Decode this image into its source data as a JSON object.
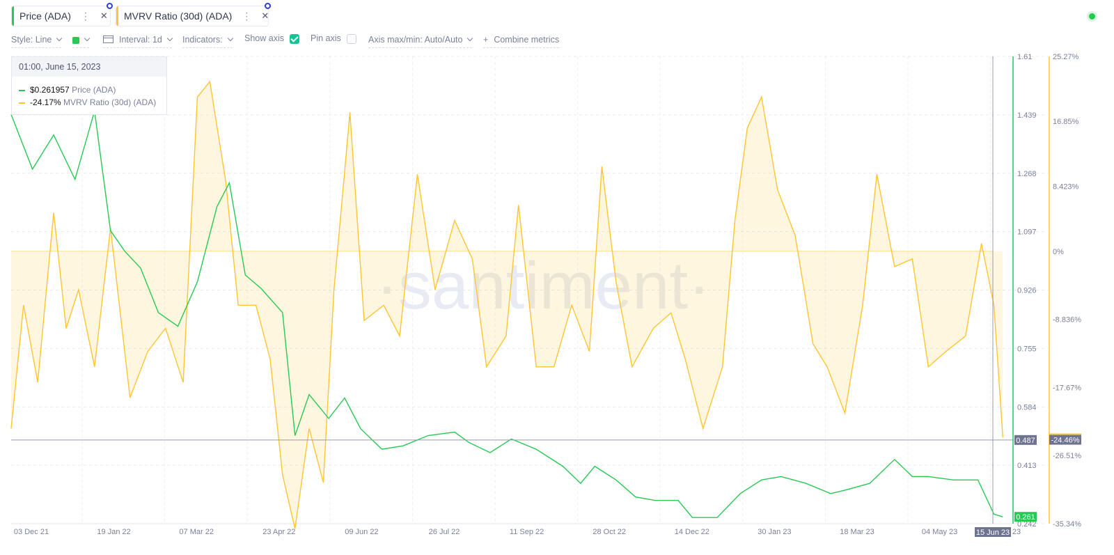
{
  "tabs": [
    {
      "label": "Price (ADA)",
      "color": "#26c953"
    },
    {
      "label": "MVRV Ratio (30d) (ADA)",
      "color": "#ffc532"
    }
  ],
  "icons": {
    "menu": "more-vertical-icon",
    "close": "close-icon",
    "settings": "settings-gear-icon",
    "status": "status-dot-icon"
  },
  "toolbar": {
    "style": "Style: Line",
    "interval": "Interval: 1d",
    "indicators": "Indicators:",
    "show_axis": "Show axis",
    "show_axis_checked": true,
    "pin_axis": "Pin axis",
    "pin_axis_checked": false,
    "axis_maxmin": "Axis max/min: Auto/Auto",
    "combine": "Combine metrics",
    "series_color": "#26c953"
  },
  "tooltip": {
    "date": "01:00, June 15, 2023",
    "rows": [
      {
        "value": "$0.261957",
        "label": "Price (ADA)",
        "color": "#26c953"
      },
      {
        "value": "-24.17%",
        "label": "MVRV Ratio (30d) (ADA)",
        "color": "#ffc532"
      }
    ]
  },
  "watermark": "·santiment·",
  "chart_data": {
    "type": "line",
    "x_labels": [
      "03 Dec 21",
      "19 Jan 22",
      "07 Mar 22",
      "23 Apr 22",
      "09 Jun 22",
      "26 Jul 22",
      "11 Sep 22",
      "28 Oct 22",
      "14 Dec 22",
      "30 Jan 23",
      "18 Mar 23",
      "04 May 23",
      "23"
    ],
    "cursor_label": "15 Jun 23",
    "price_axis": {
      "ticks": [
        "1.61",
        "1.439",
        "1.268",
        "1.097",
        "0.926",
        "0.755",
        "0.584",
        "0.413",
        "0.242"
      ],
      "min": 0.242,
      "max": 1.61,
      "crosshair_label": "0.487",
      "last_label": "0.261"
    },
    "mvrv_axis": {
      "ticks": [
        "25.27%",
        "16.85%",
        "8.423%",
        "0%",
        "-8.836%",
        "-17.67%",
        "-26.51%",
        "-35.34%"
      ],
      "min": -35.34,
      "max": 25.27,
      "last_label": "-24.46%"
    },
    "series": [
      {
        "name": "Price (ADA)",
        "color": "#26c953",
        "unit": "USD",
        "x": [
          "2021-12-03",
          "2021-12-15",
          "2021-12-27",
          "2022-01-08",
          "2022-01-19",
          "2022-01-28",
          "2022-02-05",
          "2022-02-14",
          "2022-02-24",
          "2022-03-07",
          "2022-03-18",
          "2022-03-29",
          "2022-04-05",
          "2022-04-14",
          "2022-04-23",
          "2022-05-05",
          "2022-05-12",
          "2022-05-20",
          "2022-05-31",
          "2022-06-09",
          "2022-06-18",
          "2022-06-30",
          "2022-07-12",
          "2022-07-26",
          "2022-08-10",
          "2022-08-18",
          "2022-08-30",
          "2022-09-11",
          "2022-09-25",
          "2022-10-10",
          "2022-10-20",
          "2022-10-28",
          "2022-11-09",
          "2022-11-20",
          "2022-12-01",
          "2022-12-14",
          "2022-12-22",
          "2023-01-05",
          "2023-01-18",
          "2023-01-30",
          "2023-02-10",
          "2023-02-24",
          "2023-03-10",
          "2023-03-18",
          "2023-04-01",
          "2023-04-15",
          "2023-04-25",
          "2023-05-04",
          "2023-05-18",
          "2023-06-01",
          "2023-06-10",
          "2023-06-15"
        ],
        "values": [
          1.44,
          1.28,
          1.38,
          1.25,
          1.45,
          1.1,
          1.04,
          0.99,
          0.86,
          0.82,
          0.95,
          1.17,
          1.24,
          0.97,
          0.93,
          0.86,
          0.5,
          0.62,
          0.55,
          0.61,
          0.52,
          0.46,
          0.47,
          0.5,
          0.51,
          0.48,
          0.45,
          0.49,
          0.46,
          0.41,
          0.36,
          0.41,
          0.37,
          0.32,
          0.31,
          0.31,
          0.26,
          0.26,
          0.33,
          0.37,
          0.38,
          0.36,
          0.33,
          0.34,
          0.36,
          0.43,
          0.38,
          0.38,
          0.37,
          0.37,
          0.27,
          0.262
        ]
      },
      {
        "name": "MVRV Ratio (30d) (ADA)",
        "color": "#ffc532",
        "unit": "%",
        "x": [
          "2021-12-03",
          "2021-12-10",
          "2021-12-18",
          "2021-12-27",
          "2022-01-03",
          "2022-01-10",
          "2022-01-19",
          "2022-01-28",
          "2022-02-08",
          "2022-02-18",
          "2022-02-28",
          "2022-03-10",
          "2022-03-18",
          "2022-03-25",
          "2022-04-03",
          "2022-04-10",
          "2022-04-20",
          "2022-04-28",
          "2022-05-05",
          "2022-05-12",
          "2022-05-20",
          "2022-05-28",
          "2022-06-03",
          "2022-06-12",
          "2022-06-20",
          "2022-07-01",
          "2022-07-10",
          "2022-07-20",
          "2022-07-30",
          "2022-08-10",
          "2022-08-20",
          "2022-08-28",
          "2022-09-08",
          "2022-09-15",
          "2022-09-25",
          "2022-10-05",
          "2022-10-15",
          "2022-10-25",
          "2022-11-01",
          "2022-11-09",
          "2022-11-18",
          "2022-11-30",
          "2022-12-10",
          "2022-12-18",
          "2022-12-28",
          "2023-01-08",
          "2023-01-15",
          "2023-01-22",
          "2023-01-30",
          "2023-02-08",
          "2023-02-18",
          "2023-02-28",
          "2023-03-08",
          "2023-03-18",
          "2023-03-28",
          "2023-04-05",
          "2023-04-15",
          "2023-04-25",
          "2023-05-04",
          "2023-05-14",
          "2023-05-25",
          "2023-06-03",
          "2023-06-10",
          "2023-06-15"
        ],
        "values": [
          -23,
          -7,
          -17,
          5,
          -10,
          -5,
          -15,
          3,
          -19,
          -13,
          -10,
          -17,
          20,
          22,
          9,
          -7,
          -7,
          -14,
          -29,
          -36,
          -23,
          -30,
          -5,
          18,
          -9,
          -7,
          -11,
          10,
          -5,
          4,
          -1,
          -15,
          -11,
          6,
          -15,
          -15,
          -7,
          -13,
          11,
          -4,
          -15,
          -10,
          -8,
          -14,
          -23,
          -15,
          4,
          16,
          20,
          8,
          2,
          -12,
          -15,
          -21,
          -7,
          10,
          -2,
          -1,
          -15,
          -13,
          -11,
          1,
          -7,
          -24.17
        ]
      }
    ]
  }
}
